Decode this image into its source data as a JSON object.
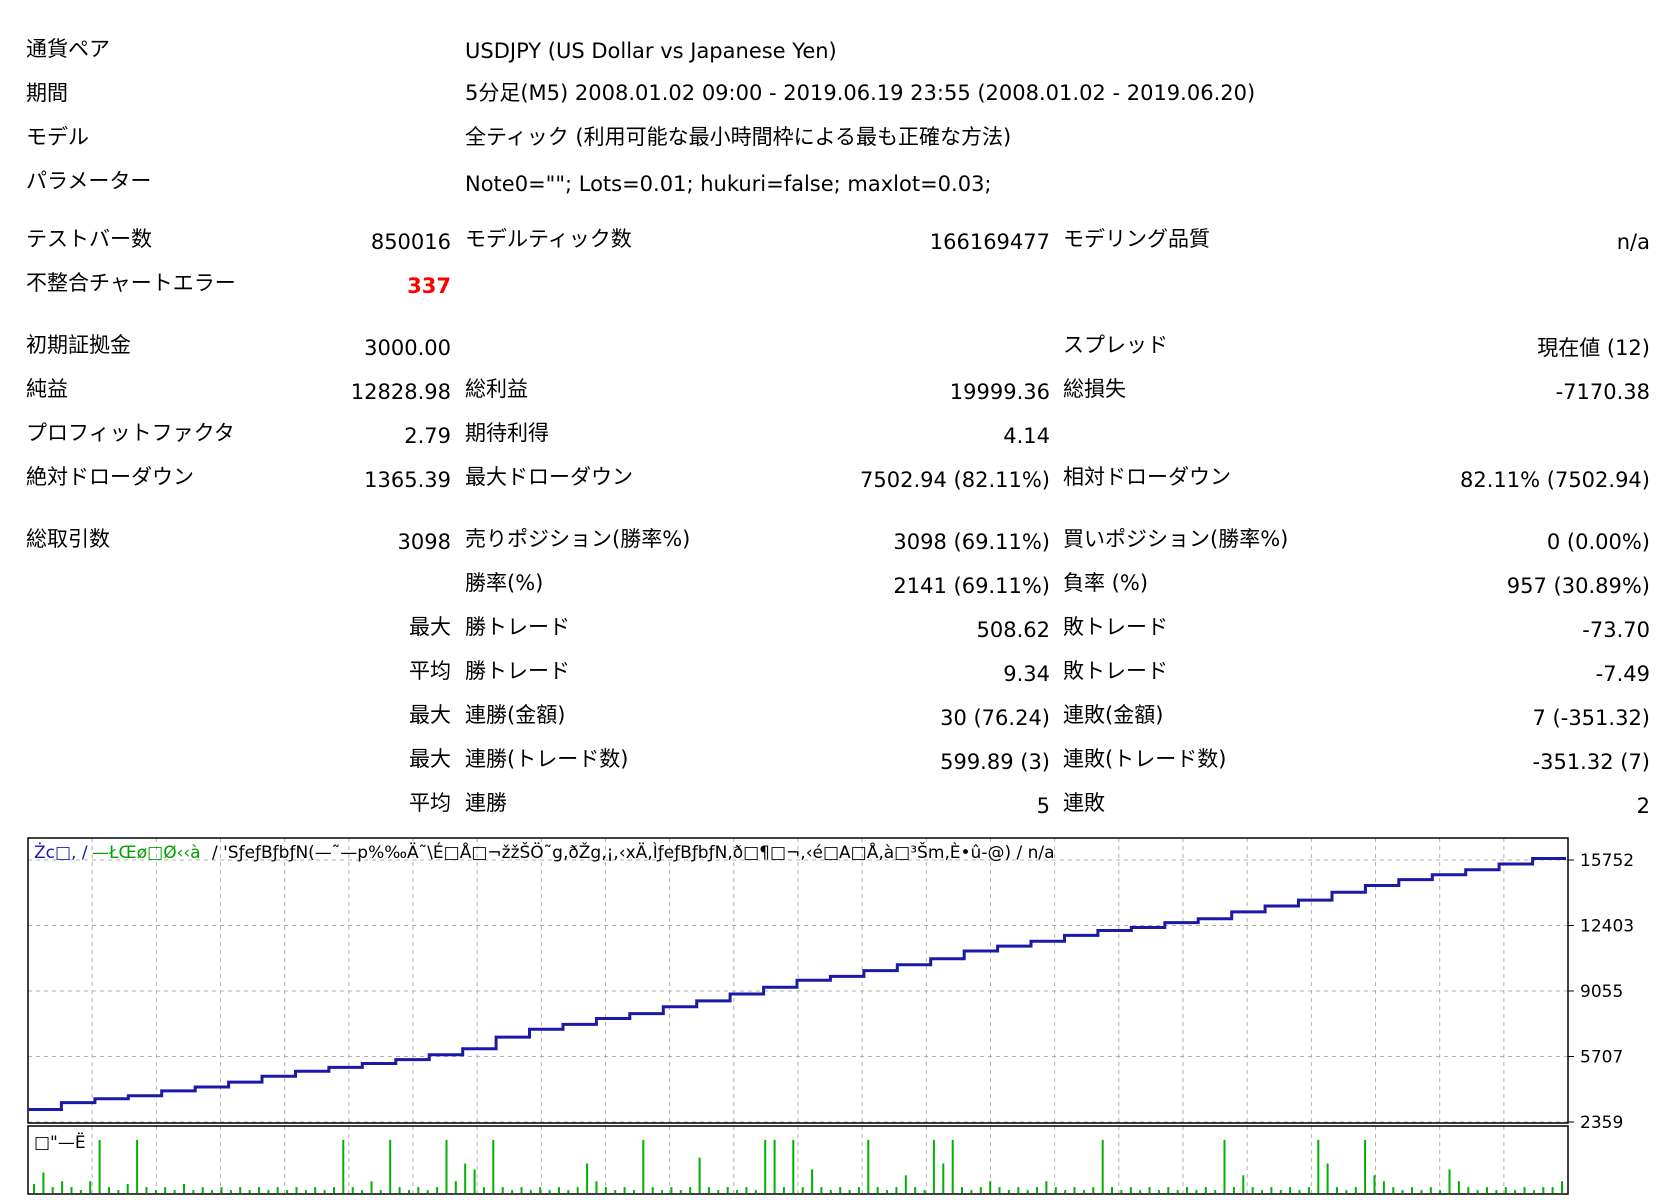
{
  "header": {
    "currency_pair_label": "通貨ペア",
    "currency_pair_value": "USDJPY (US Dollar vs Japanese Yen)",
    "period_label": "期間",
    "period_value": "5分足(M5) 2008.01.02 09:00 - 2019.06.19 23:55 (2008.01.02 - 2019.06.20)",
    "model_label": "モデル",
    "model_value": "全ティック (利用可能な最小時間枠による最も正確な方法)",
    "params_label": "パラメーター",
    "params_value": "Note0=\"\"; Lots=0.01; hukuri=false; maxlot=0.03;"
  },
  "stats": {
    "test_bars_label": "テストバー数",
    "test_bars_value": "850016",
    "model_ticks_label": "モデルティック数",
    "model_ticks_value": "166169477",
    "modeling_quality_label": "モデリング品質",
    "modeling_quality_value": "n/a",
    "mismatch_errors_label": "不整合チャートエラー",
    "mismatch_errors_value": "337",
    "initial_deposit_label": "初期証拠金",
    "initial_deposit_value": "3000.00",
    "spread_label": "スプレッド",
    "spread_value": "現在値 (12)",
    "net_profit_label": "純益",
    "net_profit_value": "12828.98",
    "gross_profit_label": "総利益",
    "gross_profit_value": "19999.36",
    "gross_loss_label": "総損失",
    "gross_loss_value": "-7170.38",
    "profit_factor_label": "プロフィットファクタ",
    "profit_factor_value": "2.79",
    "expected_payoff_label": "期待利得",
    "expected_payoff_value": "4.14",
    "abs_drawdown_label": "絶対ドローダウン",
    "abs_drawdown_value": "1365.39",
    "max_drawdown_label": "最大ドローダウン",
    "max_drawdown_value": "7502.94 (82.11%)",
    "rel_drawdown_label": "相対ドローダウン",
    "rel_drawdown_value": "82.11% (7502.94)",
    "total_trades_label": "総取引数",
    "total_trades_value": "3098",
    "short_pos_label": "売りポジション(勝率%)",
    "short_pos_value": "3098 (69.11%)",
    "long_pos_label": "買いポジション(勝率%)",
    "long_pos_value": "0 (0.00%)",
    "win_rate_label": "勝率(%)",
    "win_rate_value": "2141 (69.11%)",
    "loss_rate_label": "負率 (%)",
    "loss_rate_value": "957 (30.89%)",
    "max_label_1": "最大",
    "largest_win_label": "勝トレード",
    "largest_win_value": "508.62",
    "largest_loss_label": "敗トレード",
    "largest_loss_value": "-73.70",
    "avg_label_1": "平均",
    "avg_win_label": "勝トレード",
    "avg_win_value": "9.34",
    "avg_loss_label": "敗トレード",
    "avg_loss_value": "-7.49",
    "max_label_2": "最大",
    "max_consec_wins_amt_label": "連勝(金額)",
    "max_consec_wins_amt_value": "30 (76.24)",
    "max_consec_losses_amt_label": "連敗(金額)",
    "max_consec_losses_amt_value": "7 (-351.32)",
    "max_label_3": "最大",
    "max_consec_wins_cnt_label": "連勝(トレード数)",
    "max_consec_wins_cnt_value": "599.89 (3)",
    "max_consec_losses_cnt_label": "連敗(トレード数)",
    "max_consec_losses_cnt_value": "-351.32 (7)",
    "avg_label_2": "平均",
    "avg_consec_wins_label": "連勝",
    "avg_consec_wins_value": "5",
    "avg_consec_losses_label": "連敗",
    "avg_consec_losses_value": "2"
  },
  "chart_data": {
    "type": "line",
    "legend_blue": "Żc□, /",
    "legend_green": "—ŁŒø□Ø‹‹à",
    "legend_black": "/ 'SƒeƒBƒbƒN(—˜—p%‰Ä˜\\É□Å□¬žžŠÖ˜g‚ðŽg‚¡,‹xÄ‚ÌƒeƒBƒbƒN‚ð□¶□¬,‹é□A□Å‚à□³Šm‚È•û-@) / n/a",
    "volume_label": "□\"—Ë",
    "y_ticks": [
      2359,
      5707,
      9055,
      12403,
      15752
    ],
    "ylim": [
      2359,
      15752
    ],
    "colors": {
      "balance": "#1a1aa6",
      "volume": "#00b000",
      "grid": "#b0b0b0"
    },
    "series": [
      {
        "values": [
          3000,
          3350,
          3550,
          3700,
          3950,
          4150,
          4400,
          4700,
          4950,
          5150,
          5350,
          5550,
          5800,
          6100,
          6700,
          7100,
          7350,
          7650,
          7900,
          8250,
          8550,
          8900,
          9250,
          9600,
          9800,
          10100,
          10400,
          10700,
          11100,
          11350,
          11600,
          11900,
          12150,
          12300,
          12550,
          12750,
          13100,
          13400,
          13700,
          14100,
          14450,
          14750,
          15000,
          15250,
          15550,
          15829
        ]
      }
    ],
    "volume_values": [
      0.15,
      0.35,
      0.1,
      0.2,
      0.1,
      0.05,
      0.2,
      0.9,
      0.1,
      0.05,
      0.15,
      0.9,
      0.1,
      0.05,
      0.1,
      0.05,
      0.15,
      0.05,
      0.1,
      0.05,
      0.1,
      0.05,
      0.1,
      0.05,
      0.1,
      0.05,
      0.1,
      0.05,
      0.1,
      0.05,
      0.1,
      0.05,
      0.1,
      0.9,
      0.1,
      0.05,
      0.2,
      0.05,
      0.9,
      0.1,
      0.05,
      0.1,
      0.05,
      0.1,
      0.9,
      0.2,
      0.5,
      0.4,
      0.1,
      0.9,
      0.1,
      0.05,
      0.1,
      0.05,
      0.1,
      0.05,
      0.1,
      0.05,
      0.1,
      0.5,
      0.2,
      0.1,
      0.05,
      0.1,
      0.05,
      0.9,
      0.1,
      0.05,
      0.1,
      0.05,
      0.1,
      0.6,
      0.1,
      0.05,
      0.1,
      0.05,
      0.1,
      0.05,
      0.9,
      0.9,
      0.1,
      0.9,
      0.1,
      0.4,
      0.1,
      0.05,
      0.1,
      0.05,
      0.1,
      0.9,
      0.1,
      0.05,
      0.1,
      0.3,
      0.1,
      0.05,
      0.9,
      0.5,
      0.9,
      0.1,
      0.05,
      0.1,
      0.2,
      0.1,
      0.05,
      0.1,
      0.05,
      0.1,
      0.2,
      0.1,
      0.05,
      0.1,
      0.05,
      0.1,
      0.9,
      0.1,
      0.05,
      0.1,
      0.05,
      0.1,
      0.05,
      0.1,
      0.05,
      0.1,
      0.05,
      0.1,
      0.05,
      0.9,
      0.1,
      0.3,
      0.1,
      0.05,
      0.1,
      0.05,
      0.1,
      0.05,
      0.1,
      0.9,
      0.5,
      0.1,
      0.05,
      0.1,
      0.9,
      0.3,
      0.2,
      0.1,
      0.05,
      0.1,
      0.05,
      0.1,
      0.05,
      0.4,
      0.2,
      0.1,
      0.05,
      0.1,
      0.05,
      0.1,
      0.05,
      0.1,
      0.05,
      0.1,
      0.1,
      0.2
    ]
  }
}
